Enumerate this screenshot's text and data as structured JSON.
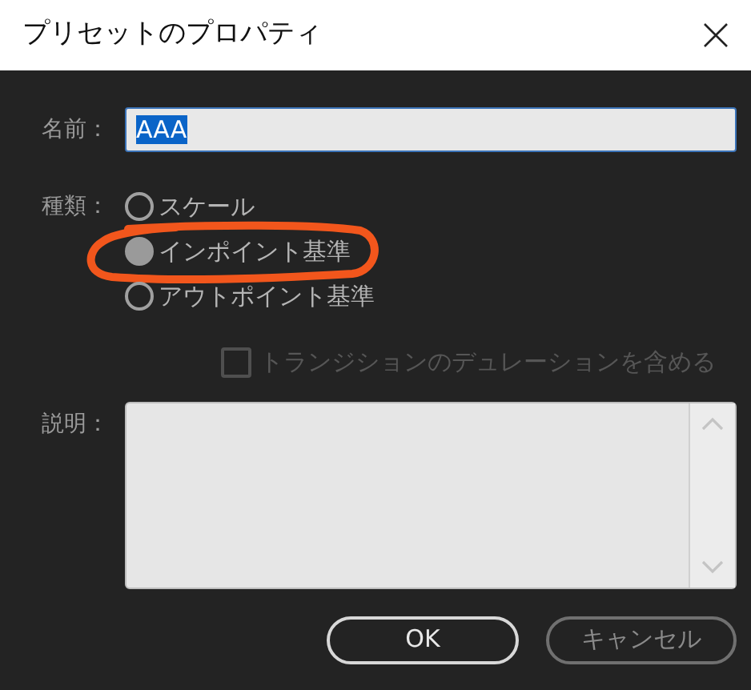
{
  "window": {
    "title": "プリセットのプロパティ"
  },
  "name": {
    "label": "名前：",
    "value": "AAA",
    "text_selected": true
  },
  "type": {
    "label": "種類：",
    "options": [
      {
        "label": "スケール",
        "selected": false,
        "circled": false
      },
      {
        "label": "インポイント基準",
        "selected": true,
        "circled": true
      },
      {
        "label": "アウトポイント基準",
        "selected": false,
        "circled": false
      }
    ]
  },
  "include_transition": {
    "label": "トランジションのデュレーションを含める",
    "checked": false,
    "disabled": true
  },
  "description": {
    "label": "説明："
  },
  "buttons": [
    {
      "label": "OK",
      "kind": "default"
    },
    {
      "label": "キャンセル",
      "kind": "secondary"
    }
  ]
}
